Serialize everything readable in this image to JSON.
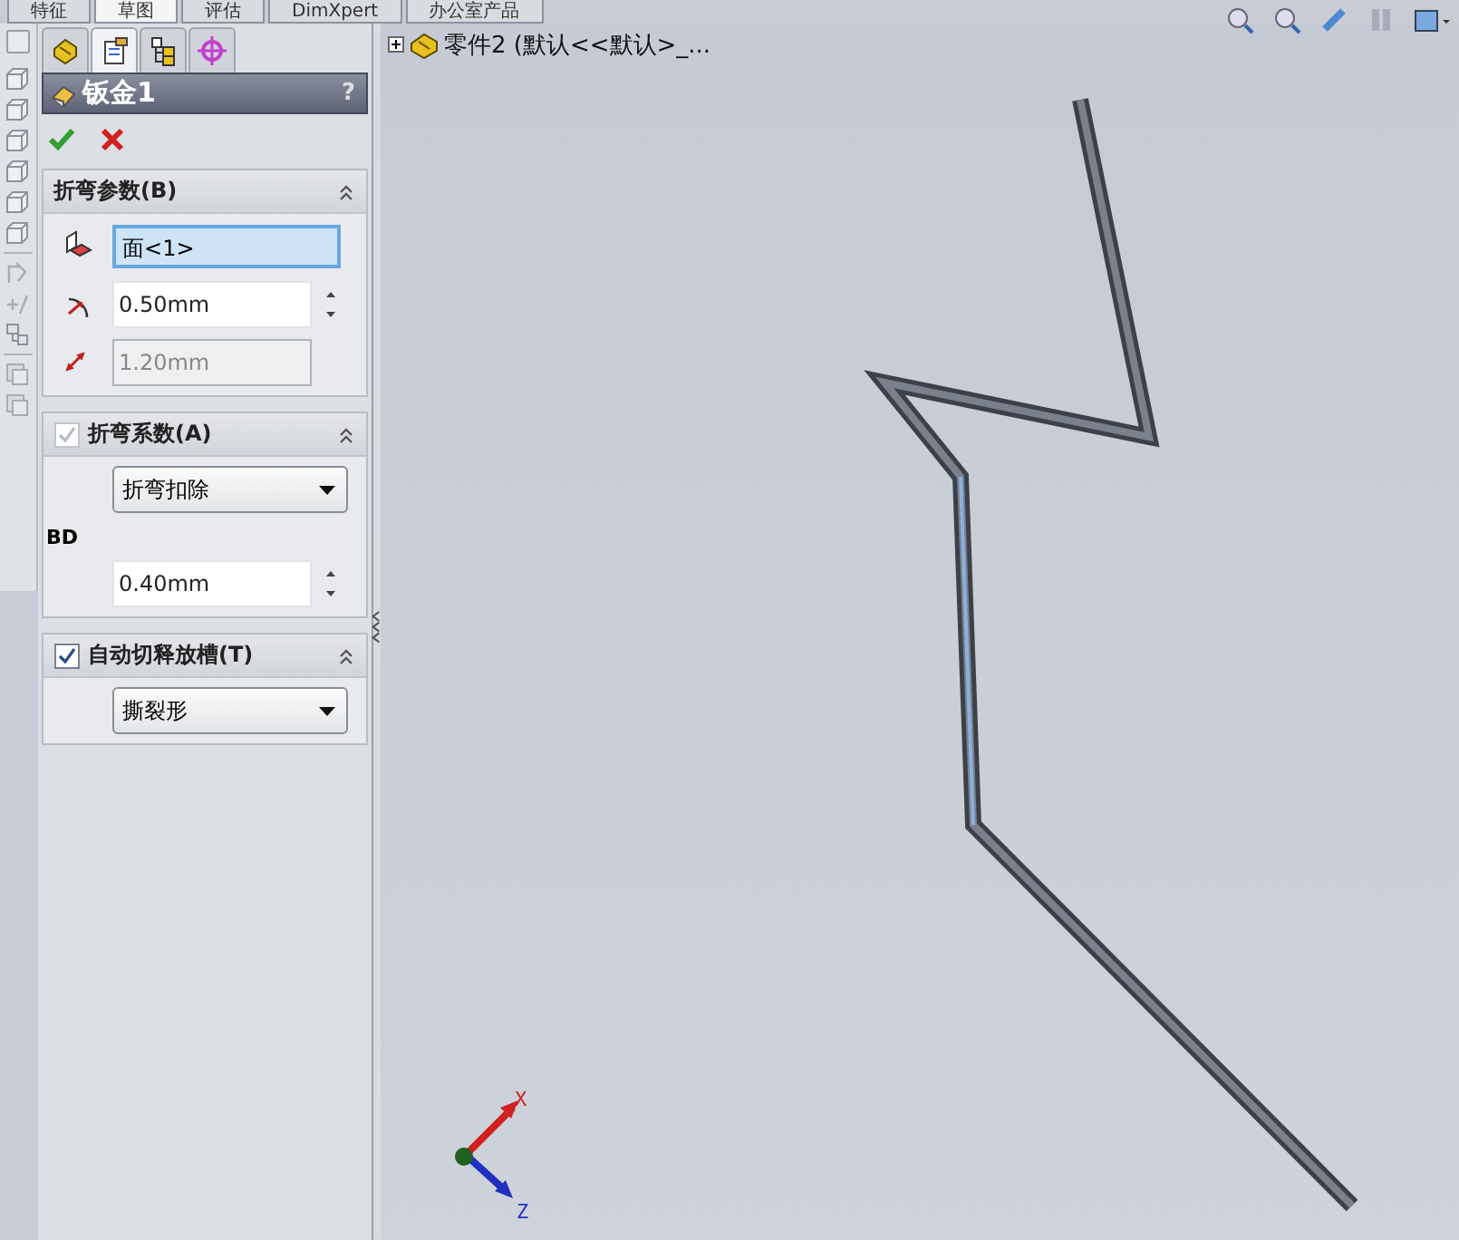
{
  "command_tabs": [
    {
      "label": "特征",
      "selected": false
    },
    {
      "label": "草图",
      "selected": true
    },
    {
      "label": "评估",
      "selected": false
    },
    {
      "label": "DimXpert",
      "selected": false
    },
    {
      "label": "办公室产品",
      "selected": false
    }
  ],
  "manager_tabs": [
    {
      "kind": "feature",
      "selected": false
    },
    {
      "kind": "property",
      "selected": true
    },
    {
      "kind": "config",
      "selected": false
    },
    {
      "kind": "dim",
      "selected": false
    }
  ],
  "property_manager": {
    "title": "钣金1",
    "help": "?",
    "sections": [
      {
        "kind": "plain",
        "title": "折弯参数(B)",
        "expanded": true,
        "rows": [
          {
            "kind": "select",
            "value": "面<1>",
            "selected": true
          },
          {
            "kind": "spin",
            "value": "0.50mm"
          },
          {
            "kind": "text",
            "value": "1.20mm",
            "disabled": true
          }
        ]
      },
      {
        "kind": "checkbox",
        "title": "折弯系数(A)",
        "checked": true,
        "disabled": true,
        "expanded": true,
        "rows": [
          {
            "kind": "dropdown",
            "value": "折弯扣除"
          },
          {
            "kind": "label",
            "value": "BD"
          },
          {
            "kind": "spin",
            "value": "0.40mm"
          }
        ]
      },
      {
        "kind": "checkbox",
        "title": "自动切释放槽(T)",
        "checked": true,
        "disabled": false,
        "expanded": true,
        "rows": [
          {
            "kind": "dropdown",
            "value": "撕裂形"
          }
        ]
      }
    ]
  },
  "tree": {
    "label": "零件2  (默认<<默认>_...",
    "expanded": false
  },
  "triad": {
    "x_label": "X",
    "z_label": "Z"
  }
}
